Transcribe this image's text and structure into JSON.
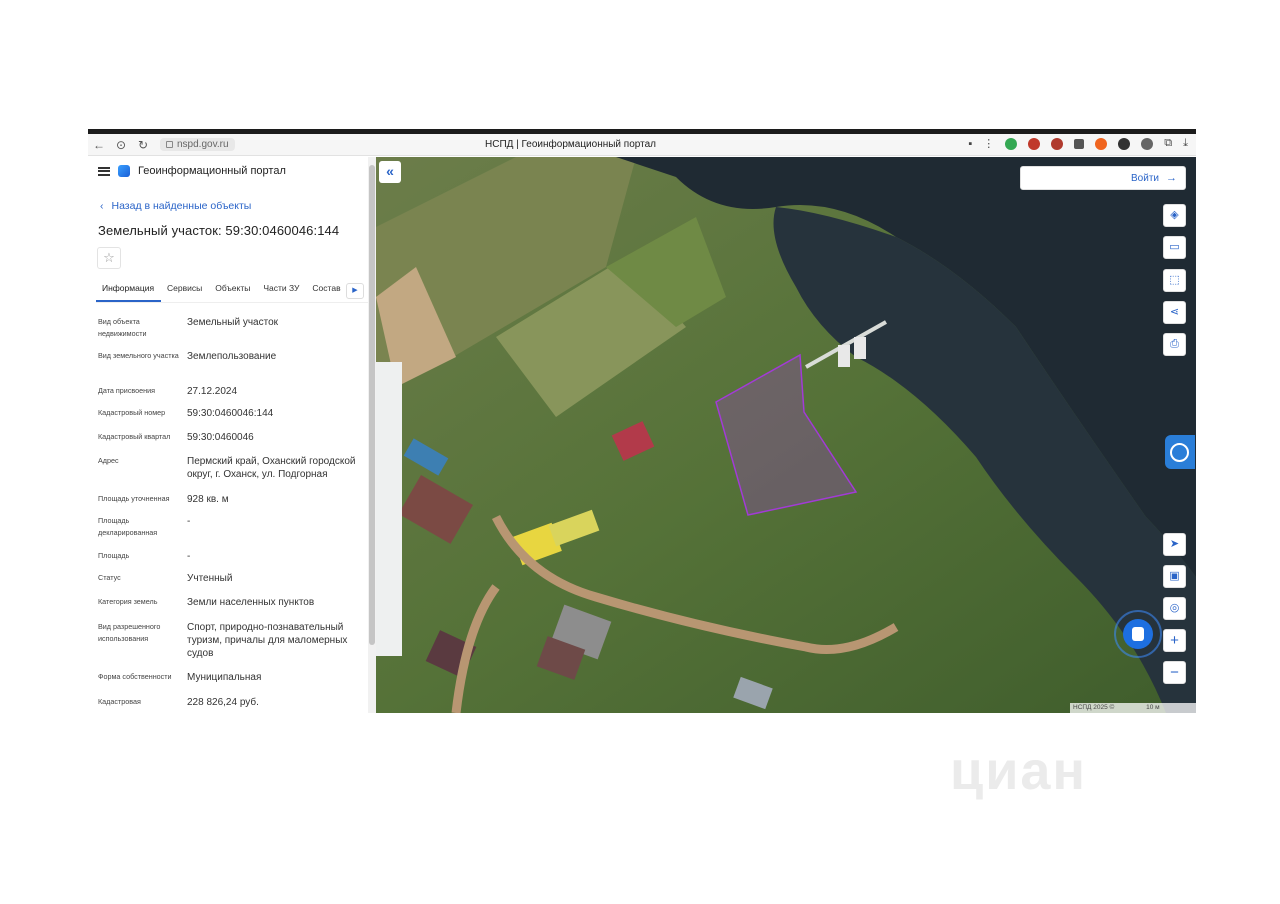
{
  "browser": {
    "url": "nspd.gov.ru",
    "tab_title": "НСПД | Геоинформационный портал"
  },
  "portal": {
    "name": "Геоинформационный портал",
    "back_link": "Назад в найденные объекты",
    "title": "Земельный участок: 59:30:0460046:144"
  },
  "tabs": [
    "Информация",
    "Сервисы",
    "Объекты",
    "Части ЗУ",
    "Состав"
  ],
  "active_tab": "Информация",
  "properties": [
    {
      "label": "Вид объекта недвижимости",
      "value": "Земельный участок"
    },
    {
      "label": "Вид земельного участка",
      "value": "Землепользование"
    },
    {
      "label": "Дата присвоения",
      "value": "27.12.2024"
    },
    {
      "label": "Кадастровый номер",
      "value": "59:30:0460046:144"
    },
    {
      "label": "Кадастровый квартал",
      "value": "59:30:0460046"
    },
    {
      "label": "Адрес",
      "value": "Пермский край, Оханский городской округ, г. Оханск, ул. Подгорная"
    },
    {
      "label": "Площадь уточненная",
      "value": "928 кв. м"
    },
    {
      "label": "Площадь декларированная",
      "value": "-"
    },
    {
      "label": "Площадь",
      "value": "-"
    },
    {
      "label": "Статус",
      "value": "Учтенный"
    },
    {
      "label": "Категория земель",
      "value": "Земли населенных пунктов"
    },
    {
      "label": "Вид разрешенного использования",
      "value": "Спорт, природно-познавательный туризм, причалы для маломерных судов"
    },
    {
      "label": "Форма собственности",
      "value": "Муниципальная"
    },
    {
      "label": "Кадастровая",
      "value": "228 826,24 руб."
    }
  ],
  "map": {
    "login_label": "Войти",
    "attribution": "НСПД 2025 ©",
    "scale_label": "10 м",
    "parcel_color": "#a23bd6",
    "water_color": "#1f2a33"
  },
  "icons": {
    "back": "chevron-left-icon",
    "collapse": "double-chevron-left-icon",
    "layers": "layers-icon",
    "ruler": "ruler-icon",
    "select": "select-area-icon",
    "share": "share-icon",
    "print": "print-icon",
    "locate": "navigation-icon",
    "basemap": "basemap-icon",
    "geo": "geolocation-icon",
    "zoom_in": "plus-icon",
    "zoom_out": "minus-icon"
  },
  "watermark": "циан"
}
